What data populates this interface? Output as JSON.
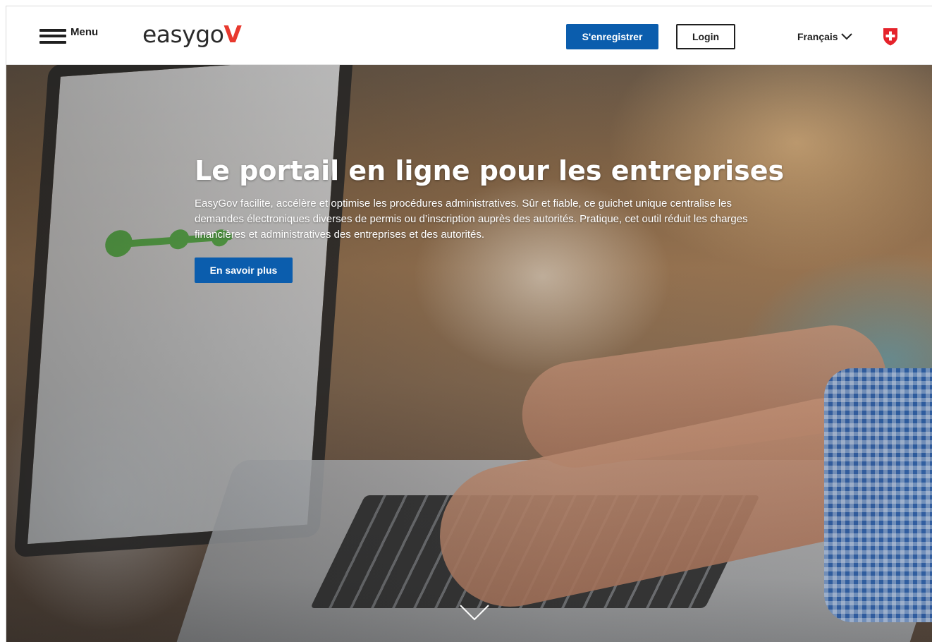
{
  "header": {
    "menu_label": "Menu",
    "logo_text": "easygo",
    "logo_accent": "V",
    "register_label": "S'enregistrer",
    "login_label": "Login",
    "language_label": "Français"
  },
  "hero": {
    "title": "Le portail en ligne pour les entreprises",
    "description": "EasyGov facilite, accélère et optimise les procédures administratives. Sûr et fiable, ce guichet unique centralise les demandes électroniques diverses de permis ou d’inscription auprès des autorités. Pratique, cet outil réduit les charges financières et administratives des entreprises et des autorités.",
    "cta_label": "En savoir plus"
  },
  "icons": {
    "menu": "hamburger-icon",
    "language_dropdown": "chevron-down-icon",
    "federal_emblem": "swiss-cross-icon",
    "scroll_down": "chevron-down-icon"
  },
  "colors": {
    "primary_blue": "#0b5dad",
    "logo_red": "#e8392e",
    "swiss_red": "#e5232b",
    "text_dark": "#1f1f1f"
  }
}
